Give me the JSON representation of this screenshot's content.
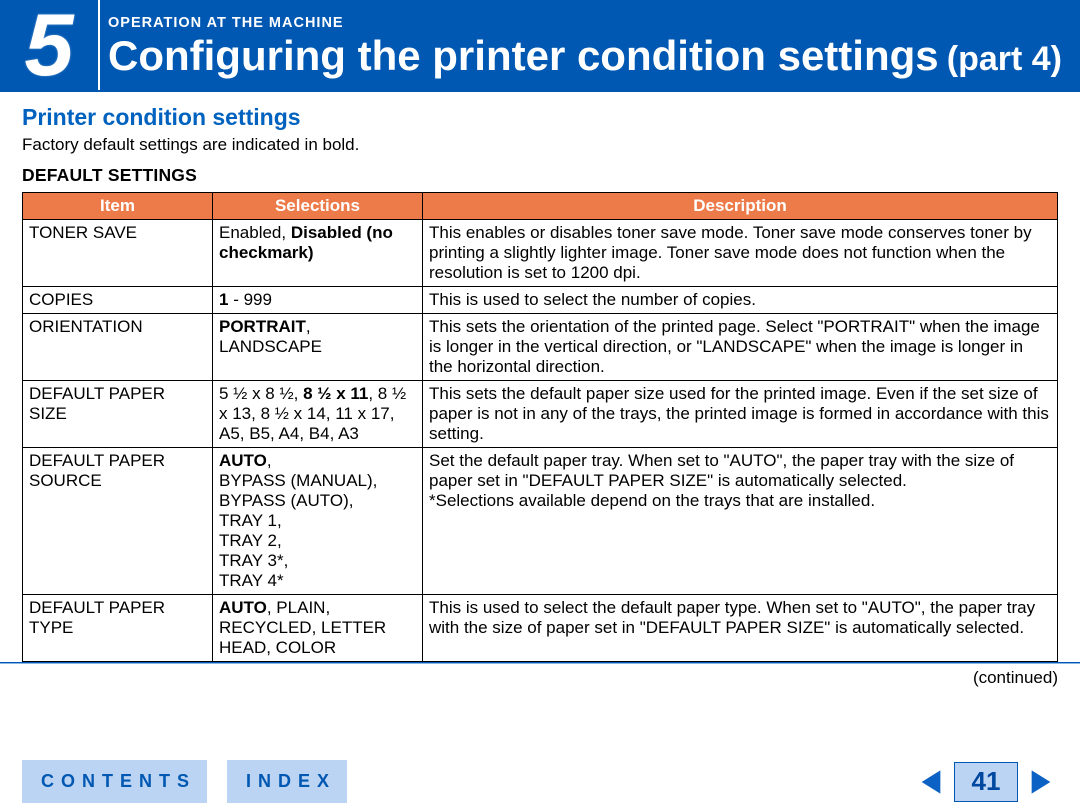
{
  "header": {
    "chapter_number": "5",
    "eyebrow": "OPERATION AT THE MACHINE",
    "title": "Configuring the printer condition settings",
    "part": "(part 4)"
  },
  "section": {
    "heading": "Printer condition settings",
    "intro": "Factory default settings are indicated in bold.",
    "subheading": "DEFAULT SETTINGS"
  },
  "table": {
    "headers": {
      "item": "Item",
      "selections": "Selections",
      "description": "Description"
    },
    "rows": [
      {
        "item": "TONER SAVE",
        "sel_prefix": "Enabled, ",
        "sel_bold": "Disabled (no checkmark)",
        "sel_suffix": "",
        "desc": "This enables or disables toner save mode. Toner save mode conserves toner by printing a slightly lighter image. Toner save mode does not function when the resolution is set to 1200 dpi."
      },
      {
        "item": "COPIES",
        "sel_prefix": "",
        "sel_bold": "1",
        "sel_suffix": " - 999",
        "desc": "This is used to select the number of copies."
      },
      {
        "item": "ORIENTATION",
        "sel_prefix": "",
        "sel_bold": "PORTRAIT",
        "sel_suffix": ", LANDSCAPE",
        "desc": "This sets the orientation of the printed page. Select \"PORTRAIT\" when the image is longer in the vertical direction, or \"LANDSCAPE\" when the image is longer in the horizontal direction."
      },
      {
        "item": "DEFAULT PAPER SIZE",
        "sel_prefix": "5 ½ x 8 ½, ",
        "sel_bold": "8 ½ x 11",
        "sel_suffix": ", 8 ½ x 13, 8 ½ x 14, 11 x 17, A5, B5, A4, B4, A3",
        "desc": "This sets the default paper size used for the printed image. Even if the set size of paper is not in any of the trays, the printed image is formed in accordance with this setting."
      },
      {
        "item": "DEFAULT PAPER SOURCE",
        "sel_prefix": "",
        "sel_bold": "AUTO",
        "sel_suffix": ",\nBYPASS (MANUAL),\nBYPASS (AUTO),\nTRAY 1,\nTRAY 2,\nTRAY 3*,\nTRAY 4*",
        "desc": "Set the default paper tray. When set to \"AUTO\", the paper tray with the size of paper set in \"DEFAULT PAPER SIZE\" is automatically selected.\n*Selections available depend on the trays that are installed."
      },
      {
        "item": "DEFAULT PAPER TYPE",
        "sel_prefix": "",
        "sel_bold": "AUTO",
        "sel_suffix": ", PLAIN, RECYCLED, LETTER HEAD, COLOR",
        "desc": "This is used to select the default paper type. When set to \"AUTO\", the paper tray with the size of paper set in \"DEFAULT PAPER SIZE\" is automatically selected."
      }
    ]
  },
  "continued_label": "(continued)",
  "footer": {
    "contents": "CONTENTS",
    "index": "INDEX",
    "page_number": "41"
  }
}
